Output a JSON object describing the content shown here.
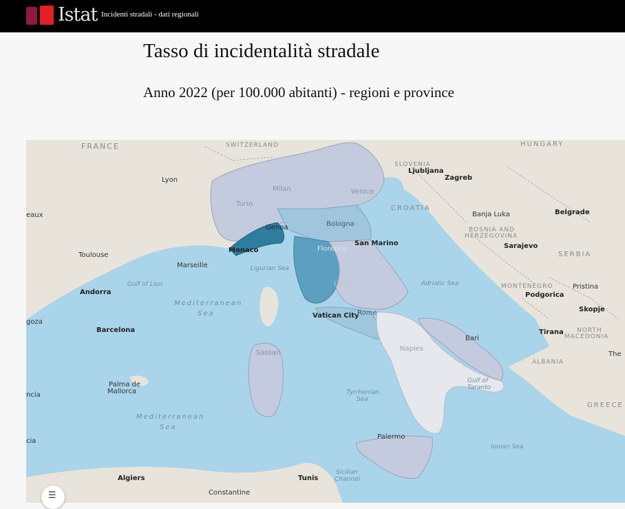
{
  "header": {
    "logo_text": "Istat",
    "app_title": "Incidenti stradali - dati regionali"
  },
  "page": {
    "title": "Tasso di incidentalità stradale",
    "subtitle": "Anno 2022 (per 100.000 abitanti) - regioni e province"
  },
  "colors": {
    "choropleth_light": "#e6e8ee",
    "choropleth_mid": "#c5cbde",
    "choropleth_blue": "#7ab4d0",
    "choropleth_dark": "#2f7d9e",
    "sea": "#aad4ea",
    "land": "#e8e4dc"
  },
  "map": {
    "countries": [
      "FRANCE",
      "SWITZERLAND",
      "HUNGARY",
      "SLOVENIA",
      "CROATIA",
      "BOSNIA AND",
      "HERZEGOVINA",
      "SERBIA",
      "MONTENEGRO",
      "NORTH",
      "MACEDONIA",
      "ALBANIA",
      "GREECE",
      "ITALY"
    ],
    "cities": [
      "Lyon",
      "Milan",
      "Turin",
      "Venice",
      "Ljubljana",
      "Zagreb",
      "Banja Luka",
      "Belgrade",
      "Bologna",
      "San Marino",
      "Genoa",
      "Monaco",
      "Marseille",
      "Toulouse",
      "Florence",
      "Sarajevo",
      "Andorra",
      "Podgorica",
      "Pristina",
      "Skopje",
      "Vatican City",
      "Rome",
      "Tirana",
      "Barcelona",
      "Bari",
      "Naples",
      "Sassari",
      "Palma de",
      "Mallorca",
      "Palermo",
      "Algiers",
      "Tunis",
      "Constantine"
    ],
    "seas": [
      "Mediterranean",
      "Sea",
      "Mediterranean",
      "Sea",
      "Ligurian Sea",
      "Gulf of Lion",
      "Adriatic Sea",
      "Tyrrhenian",
      "Sea",
      "Gulf of",
      "Taranto",
      "Ionian Sea",
      "Sicilian",
      "Channel"
    ],
    "edge_labels": [
      "eaux",
      "goza",
      "ncia",
      "cia",
      "The"
    ]
  },
  "controls": {
    "legend_icon": "list-icon",
    "legend_glyph": "☰"
  }
}
